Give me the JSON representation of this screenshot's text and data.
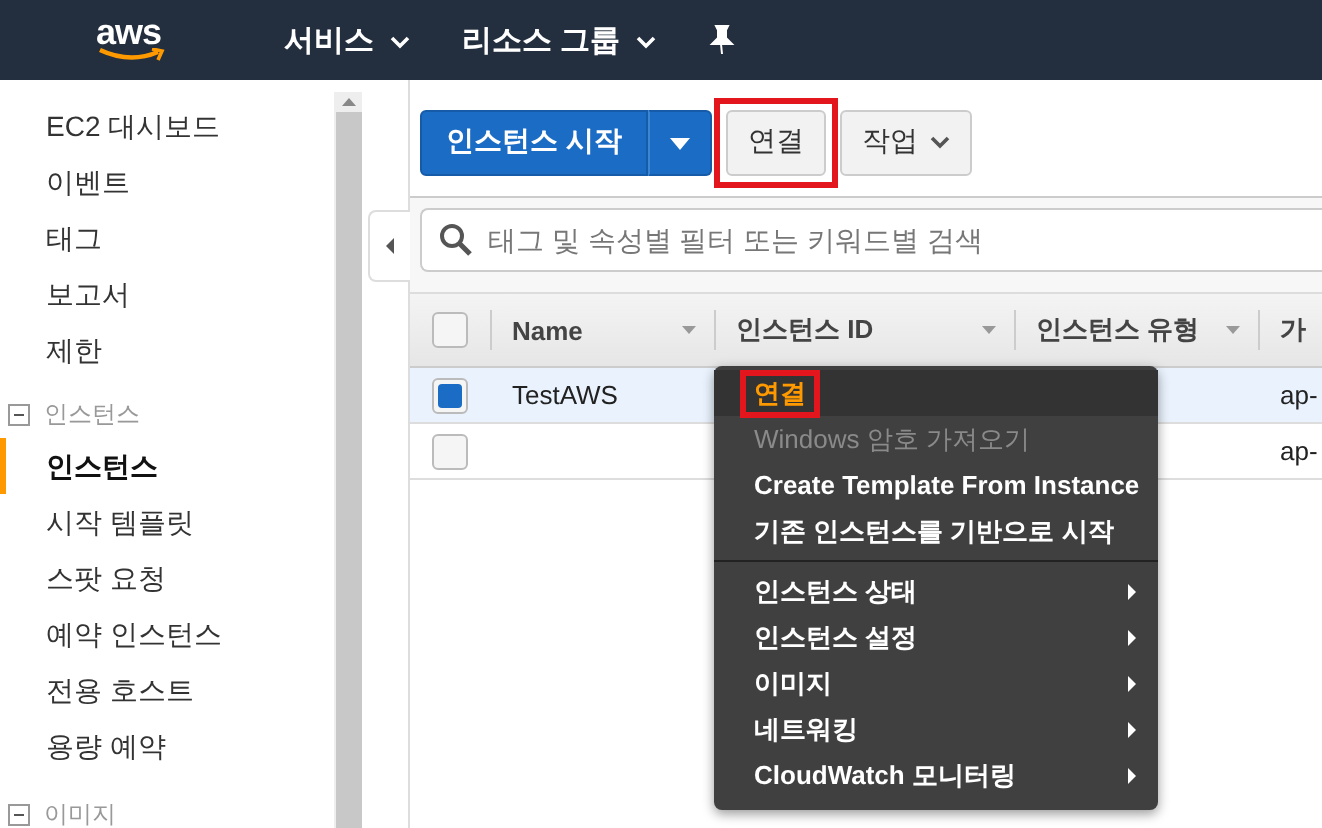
{
  "nav": {
    "logo": "aws",
    "items": [
      {
        "label": "서비스"
      },
      {
        "label": "리소스 그룹"
      }
    ]
  },
  "sidebar": {
    "sections": [
      {
        "items": [
          {
            "label": "EC2 대시보드",
            "selected": false
          },
          {
            "label": "이벤트",
            "selected": false
          },
          {
            "label": "태그",
            "selected": false
          },
          {
            "label": "보고서",
            "selected": false
          },
          {
            "label": "제한",
            "selected": false
          }
        ]
      },
      {
        "title": "인스턴스",
        "expanded": true,
        "items": [
          {
            "label": "인스턴스",
            "selected": true
          },
          {
            "label": "시작 템플릿",
            "selected": false
          },
          {
            "label": "스팟 요청",
            "selected": false
          },
          {
            "label": "예약 인스턴스",
            "selected": false
          },
          {
            "label": "전용 호스트",
            "selected": false
          },
          {
            "label": "용량 예약",
            "selected": false
          }
        ]
      },
      {
        "title": "이미지",
        "expanded": true
      }
    ]
  },
  "toolbar": {
    "launch": "인스턴스 시작",
    "connect": {
      "label": "연결",
      "highlighted": true
    },
    "actions": "작업"
  },
  "search": {
    "placeholder": "태그 및 속성별 필터 또는 키워드별 검색"
  },
  "table": {
    "header_checked": false,
    "columns": [
      "Name",
      "인스턴스 ID",
      "인스턴스 유형",
      "가"
    ],
    "rows": [
      {
        "selected": true,
        "cells": [
          "TestAWS",
          "",
          "",
          "ap-"
        ]
      },
      {
        "selected": false,
        "cells": [
          "",
          "",
          "",
          "ap-"
        ]
      }
    ]
  },
  "context_menu": {
    "items": [
      {
        "label": "연결",
        "kind": "action",
        "highlighted": true,
        "hovered": true,
        "disabled": false
      },
      {
        "label": "Windows 암호 가져오기",
        "kind": "action",
        "highlighted": false,
        "hovered": false,
        "disabled": true
      },
      {
        "label": "Create Template From Instance",
        "kind": "action",
        "highlighted": false,
        "hovered": false,
        "disabled": false
      },
      {
        "label": "기존 인스턴스를 기반으로 시작",
        "kind": "action",
        "highlighted": false,
        "hovered": false,
        "disabled": false
      },
      {
        "kind": "separator"
      },
      {
        "label": "인스턴스 상태",
        "kind": "submenu",
        "highlighted": false,
        "hovered": false,
        "disabled": false
      },
      {
        "label": "인스턴스 설정",
        "kind": "submenu",
        "highlighted": false,
        "hovered": false,
        "disabled": false
      },
      {
        "label": "이미지",
        "kind": "submenu",
        "highlighted": false,
        "hovered": false,
        "disabled": false
      },
      {
        "label": "네트워킹",
        "kind": "submenu",
        "highlighted": false,
        "hovered": false,
        "disabled": false
      },
      {
        "label": "CloudWatch 모니터링",
        "kind": "submenu",
        "highlighted": false,
        "hovered": false,
        "disabled": false
      }
    ]
  }
}
